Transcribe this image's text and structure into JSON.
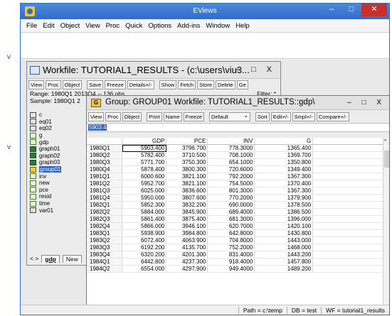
{
  "app": {
    "title": "EViews",
    "controls": {
      "minimize": "–",
      "maximize": "□",
      "close": "✕"
    },
    "icon": "eviews-logo-icon"
  },
  "side_marks": [
    "v",
    "v"
  ],
  "menu": [
    "File",
    "Edit",
    "Object",
    "View",
    "Proc",
    "Quick",
    "Options",
    "Add-ins",
    "Window",
    "Help"
  ],
  "workfile": {
    "title": "Workfile: TUTORIAL1_RESULTS - (c:\\users\\viu3...",
    "controls": "– □ X",
    "toolbar": [
      "View",
      "Proc",
      "Object",
      "|",
      "Save",
      "Freeze",
      "Details+/-",
      "|",
      "Show",
      "Fetch",
      "Store",
      "Delete",
      "Ge"
    ],
    "range": "Range:  1980Q1 2013Q4  --  136 obs",
    "range_right": "Filter: *",
    "sample": "Sample: 1980Q1 2",
    "objects": [
      {
        "type": "coef",
        "name": "c"
      },
      {
        "type": "eq",
        "name": "eq01"
      },
      {
        "type": "eq",
        "name": "eq02"
      },
      {
        "type": "ser",
        "name": "g"
      },
      {
        "type": "ser",
        "name": "gdp"
      },
      {
        "type": "graph",
        "name": "graph01"
      },
      {
        "type": "graph",
        "name": "graph02"
      },
      {
        "type": "graph",
        "name": "graph03"
      },
      {
        "type": "group",
        "name": "group01"
      },
      {
        "type": "ser",
        "name": "inv"
      },
      {
        "type": "ser",
        "name": "new"
      },
      {
        "type": "ser",
        "name": "pce"
      },
      {
        "type": "ser",
        "name": "resid"
      },
      {
        "type": "ser",
        "name": "time"
      },
      {
        "type": "alpha",
        "name": "var01"
      }
    ],
    "selected": "group01",
    "tabs": {
      "nav": "< >",
      "active": "gdp",
      "other": "New"
    }
  },
  "group": {
    "icon_letter": "G",
    "title": "Group: GROUP01   Workfile: TUTORIAL1_RESULTS::gdp\\",
    "controls": "– □ X",
    "toolbar": [
      "View",
      "Proc",
      "Object",
      "|",
      "Print",
      "Name",
      "Freeze",
      "|",
      "Default",
      "|",
      "Sort",
      "Edit+/-",
      "Smpl+/-",
      "Compare+/-"
    ],
    "edit_value": "5903.4",
    "columns": [
      "GDP",
      "PCE",
      "INV",
      "G"
    ],
    "rows": [
      [
        "1980Q1",
        "5903.400",
        "3796.700",
        "778.3000",
        "1365.400"
      ],
      [
        "1980Q2",
        "5782.400",
        "3710.500",
        "708.1000",
        "1369.700"
      ],
      [
        "1980Q3",
        "5771.700",
        "3750.300",
        "654.1000",
        "1350.800"
      ],
      [
        "1980Q4",
        "5878.400",
        "3800.300",
        "720.6000",
        "1349.400"
      ],
      [
        "1981Q1",
        "6000.600",
        "3821.100",
        "792.2000",
        "1367.300"
      ],
      [
        "1981Q2",
        "5952.700",
        "3821.100",
        "754.5000",
        "1370.400"
      ],
      [
        "1981Q3",
        "6025.000",
        "3836.600",
        "801.3000",
        "1367.300"
      ],
      [
        "1981Q4",
        "5950.000",
        "3807.600",
        "770.2000",
        "1379.900"
      ],
      [
        "1982Q1",
        "5852.300",
        "3832.200",
        "690.0000",
        "1378.500"
      ],
      [
        "1982Q2",
        "5884.000",
        "3845.900",
        "689.4000",
        "1386.500"
      ],
      [
        "1982Q3",
        "5861.400",
        "3875.400",
        "681.3000",
        "1396.000"
      ],
      [
        "1982Q4",
        "5866.000",
        "3946.100",
        "620.7000",
        "1420.100"
      ],
      [
        "1983Q1",
        "5938.900",
        "3984.800",
        "642.8000",
        "1430.800"
      ],
      [
        "1983Q2",
        "6072.400",
        "4063.900",
        "704.8000",
        "1443.000"
      ],
      [
        "1983Q3",
        "6192.200",
        "4135.700",
        "752.2000",
        "1468.000"
      ],
      [
        "1983Q4",
        "6320.200",
        "4201.300",
        "831.4000",
        "1443.200"
      ],
      [
        "1984Q1",
        "6442.800",
        "4237.300",
        "918.4000",
        "1457.800"
      ],
      [
        "1984Q2",
        "6554.000",
        "4297.900",
        "949.4000",
        "1489.200"
      ]
    ]
  },
  "status": {
    "path": "Path = c:\\temp",
    "db": "DB = test",
    "wf": "WF = tutorial1_results"
  }
}
